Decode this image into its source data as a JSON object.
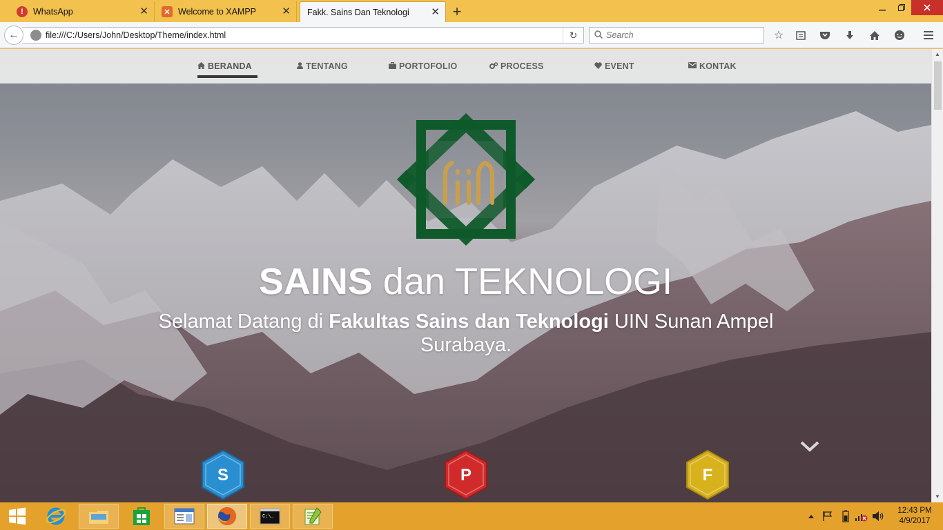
{
  "browser": {
    "tabs": [
      {
        "title": "WhatsApp",
        "icon": "whatsapp-alert-icon",
        "active": false
      },
      {
        "title": "Welcome to XAMPP",
        "icon": "xampp-icon",
        "active": false
      },
      {
        "title": "Fakk. Sains Dan Teknologi",
        "icon": "",
        "active": true
      }
    ],
    "new_tab_label": "+",
    "url": "file:///C:/Users/John/Desktop/Theme/index.html",
    "search_placeholder": "Search"
  },
  "site": {
    "nav": [
      {
        "label": "BERANDA",
        "icon": "home-icon",
        "active": true
      },
      {
        "label": "TENTANG",
        "icon": "user-icon",
        "active": false
      },
      {
        "label": "PORTOFOLIO",
        "icon": "briefcase-icon",
        "active": false
      },
      {
        "label": "PROCESS",
        "icon": "cogs-icon",
        "active": false
      },
      {
        "label": "EVENT",
        "icon": "heart-icon",
        "active": false
      },
      {
        "label": "KONTAK",
        "icon": "envelope-icon",
        "active": false
      }
    ],
    "hero": {
      "title_bold": "SAINS",
      "title_rest": " dan TEKNOLOGI",
      "subtitle_pre": "Selamat Datang di ",
      "subtitle_bold": "Fakultas Sains dan Teknologi",
      "subtitle_post": " UIN Sunan Ampel Surabaya.",
      "logo_text": "UIN"
    },
    "badges": [
      {
        "letter": "S",
        "color": "#2a8fd0"
      },
      {
        "letter": "P",
        "color": "#d12a2a"
      },
      {
        "letter": "F",
        "color": "#d8b21c"
      }
    ]
  },
  "colors": {
    "logo_green": "#0f5a2a",
    "logo_gold": "#c9a04a",
    "titlebar": "#f2c14e",
    "taskbar": "#e4a22c"
  },
  "taskbar": {
    "clock_time": "12:43 PM",
    "clock_date": "4/9/2017",
    "apps": [
      "start-icon",
      "internet-explorer-icon",
      "file-explorer-icon",
      "store-icon",
      "notepad-window-icon",
      "firefox-icon",
      "command-prompt-icon",
      "notepad-plus-plus-icon"
    ]
  }
}
